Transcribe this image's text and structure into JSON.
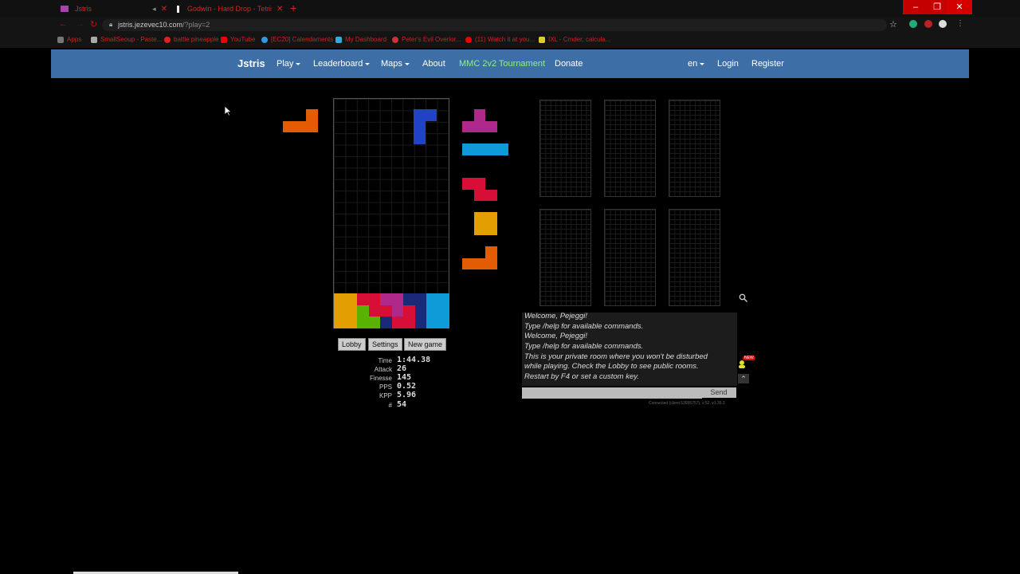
{
  "browser": {
    "tabs": [
      {
        "title": "Jstris"
      },
      {
        "title": "Godwin - Hard Drop - Tetris W..."
      }
    ],
    "url_host": "jstris.jezevec10.com",
    "url_path": "/?play=2",
    "bookmarks": [
      "Apps",
      "SmallSeoup - Paste...",
      "battle pineapple",
      "YouTube",
      "[EC20] Calendaments",
      "My Dashboard",
      "Peter's Evil Overlor...",
      "(11) Watch it at you...",
      "IXL - Cmder, calcula..."
    ],
    "window_buttons": [
      "–",
      "❐",
      "✕"
    ]
  },
  "site_nav": {
    "brand": "Jstris",
    "items": [
      "Play",
      "Leaderboard",
      "Maps",
      "About",
      "MMC 2v2 Tournament",
      "Donate"
    ],
    "lang": "en",
    "login": "Login",
    "register": "Register",
    "tournament_color": "#8ef08e"
  },
  "game": {
    "buttons": {
      "lobby": "Lobby",
      "settings": "Settings",
      "new_game": "New game"
    },
    "stats": [
      {
        "label": "Time",
        "value": "1:44.38"
      },
      {
        "label": "Attack",
        "value": "26"
      },
      {
        "label": "Finesse",
        "value": "145"
      },
      {
        "label": "PPS",
        "value": "0.52"
      },
      {
        "label": "KPP",
        "value": "5.96"
      },
      {
        "label": "#",
        "value": "54"
      }
    ],
    "hold_piece": "L",
    "queue": [
      "T",
      "I",
      "Z",
      "O",
      "L"
    ],
    "active_piece": "J",
    "colors": {
      "L": "#e35b02",
      "T": "#af298a",
      "I": "#0f9bd7",
      "Z": "#d70f37",
      "O": "#e39f02",
      "J": "#2141c6",
      "S": "#59b101"
    }
  },
  "chat": {
    "messages": [
      "Welcome, Pejeggi!",
      "Type /help for available commands.",
      "Welcome, Pejeggi!",
      "Type /help for available commands.",
      "This is your private room where you won't be disturbed",
      "while playing. Check the Lobby to see public rooms.",
      "Restart by F4 or set a custom key."
    ],
    "send_label": "Send",
    "new_badge": "NEW",
    "connection": "Connected (client 53995757), s:52, v1.39.3"
  }
}
